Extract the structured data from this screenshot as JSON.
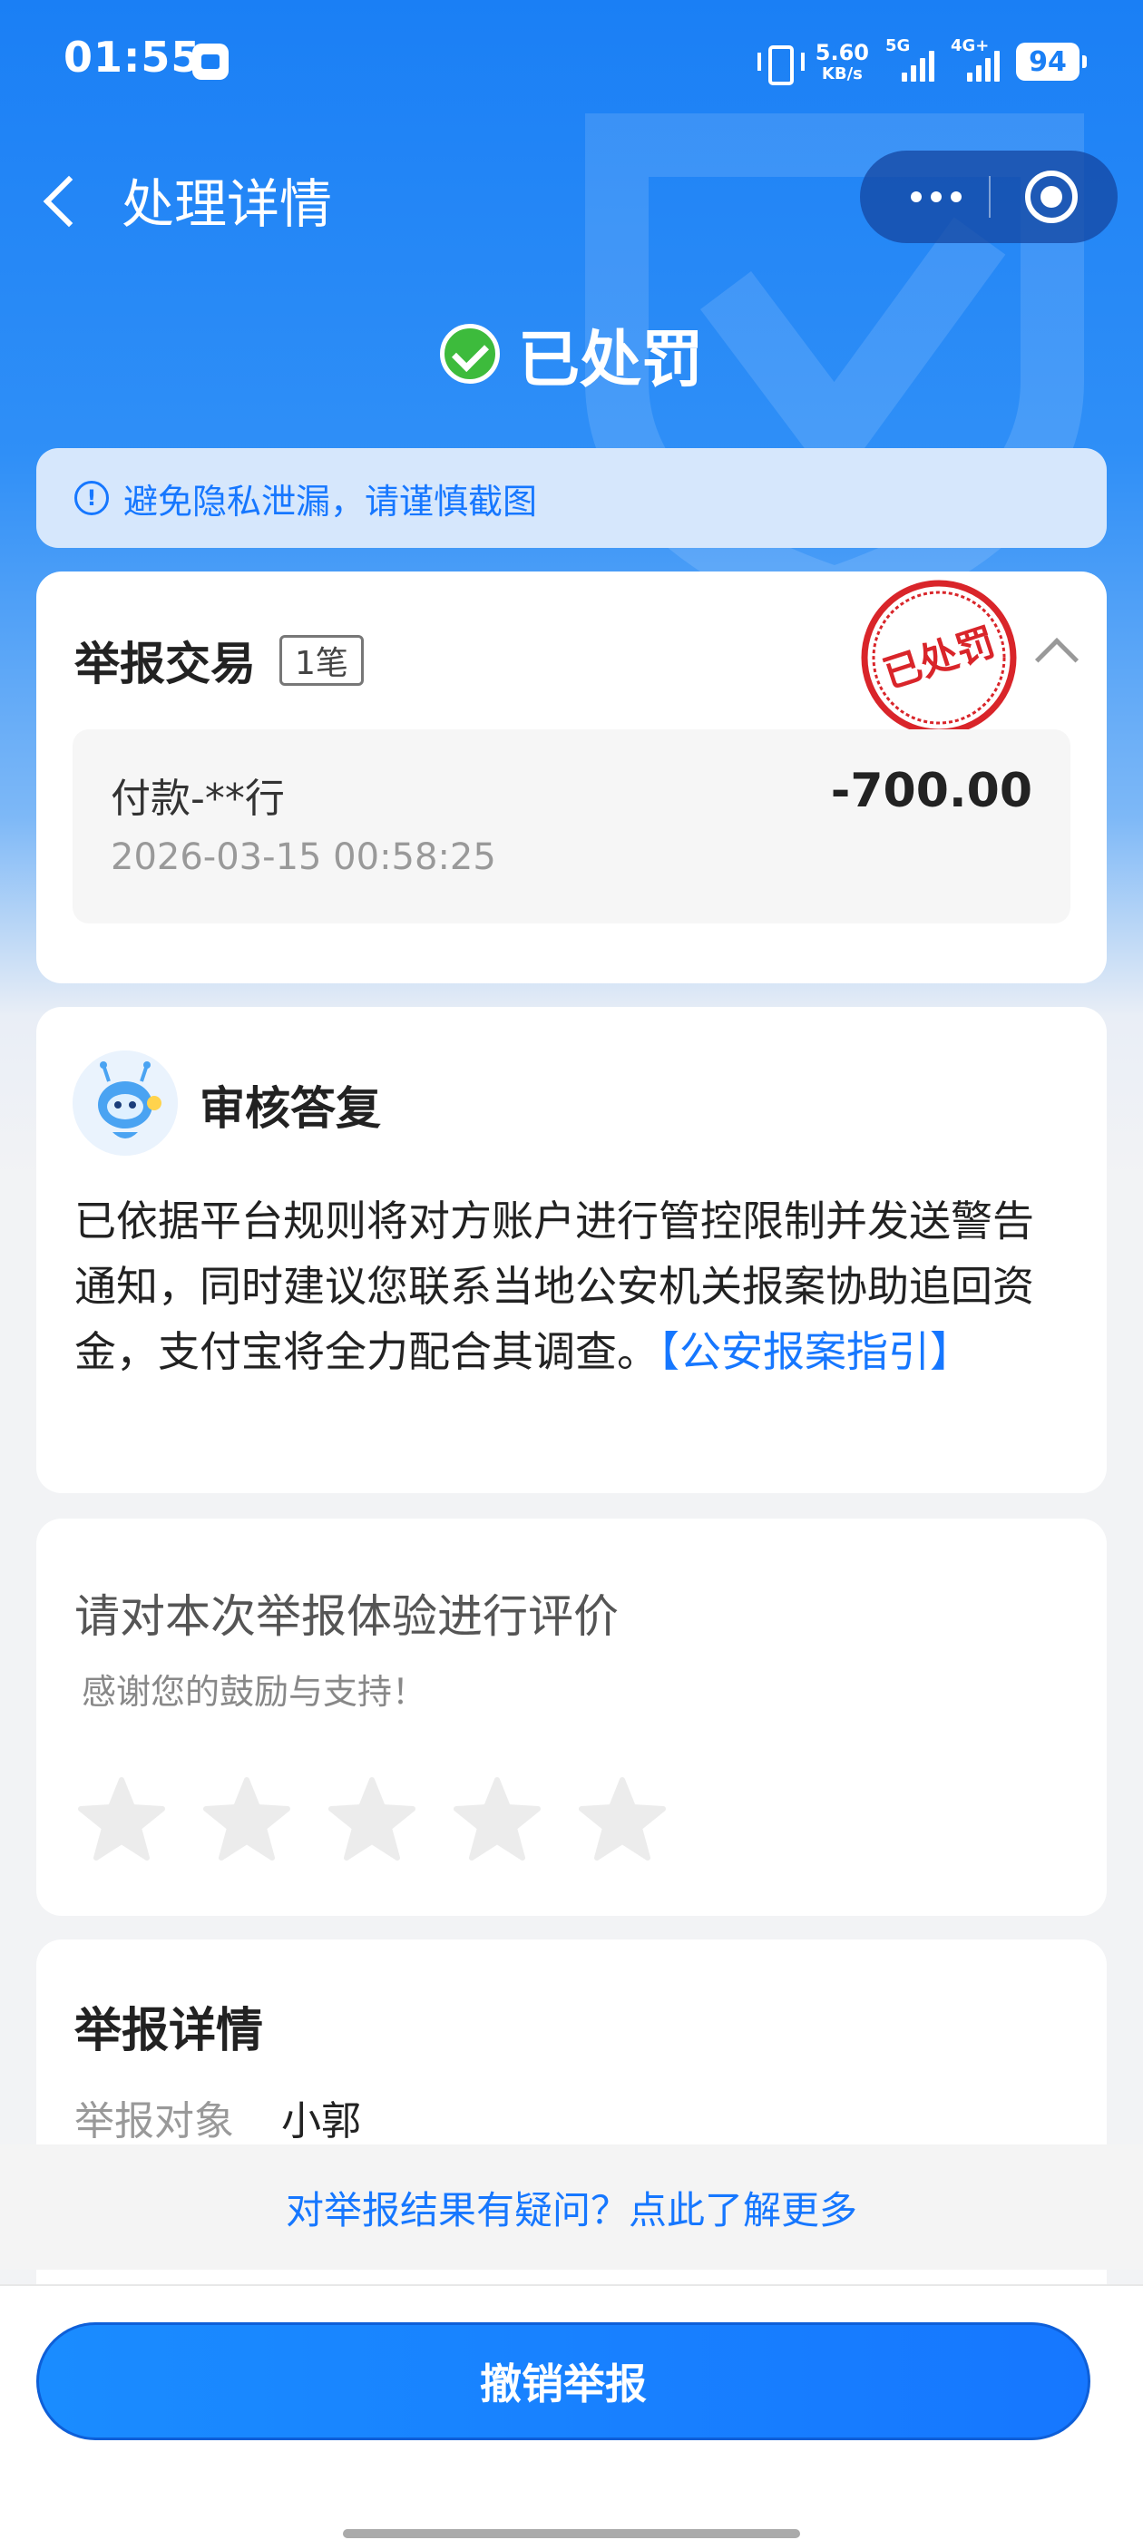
{
  "status_bar": {
    "time": "01:55",
    "speed_value": "5.60",
    "speed_unit": "KB/s",
    "net1": "5G",
    "net2": "4G+",
    "battery": "94"
  },
  "nav": {
    "title": "处理详情"
  },
  "result": {
    "status": "已处罚",
    "status_color": "#3dbb3c"
  },
  "privacy": {
    "text": "避免隐私泄漏，请谨慎截图"
  },
  "report_transaction": {
    "title": "举报交易",
    "count": "1笔",
    "stamp_text": "已处罚",
    "transaction": {
      "name": "付款-**行",
      "amount": "-700.00",
      "time": "2026-03-15 00:58:25"
    }
  },
  "review": {
    "title": "审核答复",
    "body": "已依据平台规则将对方账户进行管控限制并发送警告通知，同时建议您联系当地公安机关报案协助追回资金，支付宝将全力配合其调查。",
    "link": "【公安报案指引】"
  },
  "rating": {
    "title": "请对本次举报体验进行评价",
    "subtitle": "感谢您的鼓励与支持！",
    "stars": 5,
    "selected": 0
  },
  "report_details": {
    "title": "举报详情",
    "target_label": "举报对象",
    "target_value": "小郭"
  },
  "question": {
    "text": "对举报结果有疑问？点此了解更多"
  },
  "bottom": {
    "revoke_label": "撤销举报"
  },
  "colors": {
    "brand": "#1677ff",
    "stamp": "#d9252a"
  }
}
